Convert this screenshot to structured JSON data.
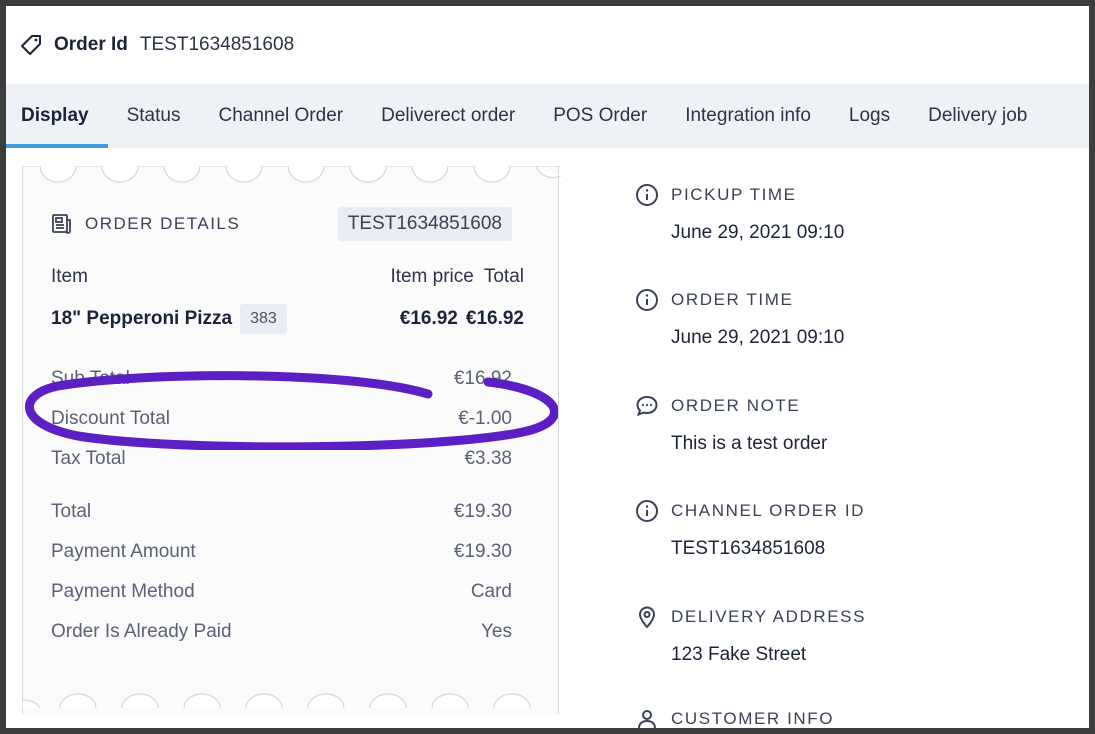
{
  "header": {
    "label": "Order Id",
    "value": "TEST1634851608"
  },
  "tabs": [
    {
      "label": "Display",
      "active": true
    },
    {
      "label": "Status"
    },
    {
      "label": "Channel Order"
    },
    {
      "label": "Deliverect order"
    },
    {
      "label": "POS Order"
    },
    {
      "label": "Integration info"
    },
    {
      "label": "Logs"
    },
    {
      "label": "Delivery job"
    }
  ],
  "receipt": {
    "title": "ORDER DETAILS",
    "badge": "TEST1634851608",
    "columns": {
      "item": "Item",
      "item_price": "Item price",
      "total": "Total"
    },
    "item": {
      "name": "18\" Pepperoni Pizza",
      "code": "383",
      "price": "€16.92",
      "total": "€16.92"
    },
    "sub_total": {
      "label": "Sub Total",
      "value": "€16.92"
    },
    "discount_total": {
      "label": "Discount Total",
      "value": "€-1.00"
    },
    "tax_total": {
      "label": "Tax Total",
      "value": "€3.38"
    },
    "total": {
      "label": "Total",
      "value": "€19.30"
    },
    "payment_amount": {
      "label": "Payment Amount",
      "value": "€19.30"
    },
    "payment_method": {
      "label": "Payment Method",
      "value": "Card"
    },
    "already_paid": {
      "label": "Order Is Already Paid",
      "value": "Yes"
    }
  },
  "side": {
    "pickup_time": {
      "label": "PICKUP TIME",
      "value": "June 29, 2021 09:10"
    },
    "order_time": {
      "label": "ORDER TIME",
      "value": "June 29, 2021 09:10"
    },
    "order_note": {
      "label": "ORDER NOTE",
      "value": "This is a test order"
    },
    "channel_order_id": {
      "label": "CHANNEL ORDER ID",
      "value": "TEST1634851608"
    },
    "delivery_address": {
      "label": "DELIVERY ADDRESS",
      "value": "123 Fake Street"
    },
    "customer_info": {
      "label": "CUSTOMER INFO"
    }
  },
  "colors": {
    "tab_active_underline": "#3f9ee0",
    "highlight_oval": "#5b1fc4",
    "tab_bar_bg": "#eef1f6"
  }
}
